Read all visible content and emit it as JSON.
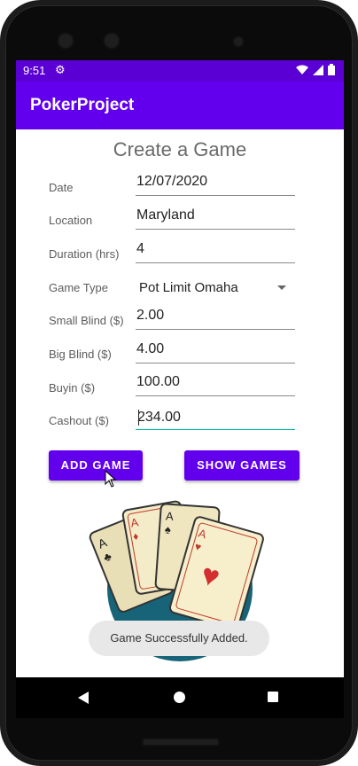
{
  "status_bar": {
    "time": "9:51"
  },
  "app_bar": {
    "title": "PokerProject"
  },
  "form": {
    "heading": "Create a Game",
    "date": {
      "label": "Date",
      "value": "12/07/2020"
    },
    "location": {
      "label": "Location",
      "value": "Maryland"
    },
    "duration": {
      "label": "Duration (hrs)",
      "value": "4"
    },
    "game_type": {
      "label": "Game Type",
      "selected": "Pot Limit Omaha"
    },
    "small_blind": {
      "label": "Small Blind ($)",
      "value": "2.00"
    },
    "big_blind": {
      "label": "Big Blind ($)",
      "value": "4.00"
    },
    "buyin": {
      "label": "Buyin ($)",
      "value": "100.00"
    },
    "cashout": {
      "label": "Cashout ($)",
      "value": "234.00"
    }
  },
  "buttons": {
    "add_game": "ADD GAME",
    "show_games": "SHOW GAMES"
  },
  "toast": {
    "message": "Game Successfully Added."
  },
  "icons": {
    "status": [
      "gear-icon",
      "wifi-icon",
      "signal-icon",
      "battery-icon"
    ],
    "nav": [
      "back-icon",
      "home-icon",
      "recents-icon"
    ]
  },
  "colors": {
    "app_bar": "#6200ee",
    "status_bar": "#5b00d4",
    "button": "#6200ee",
    "focus_underline": "#00bfa5",
    "card_circle": "#176478"
  }
}
